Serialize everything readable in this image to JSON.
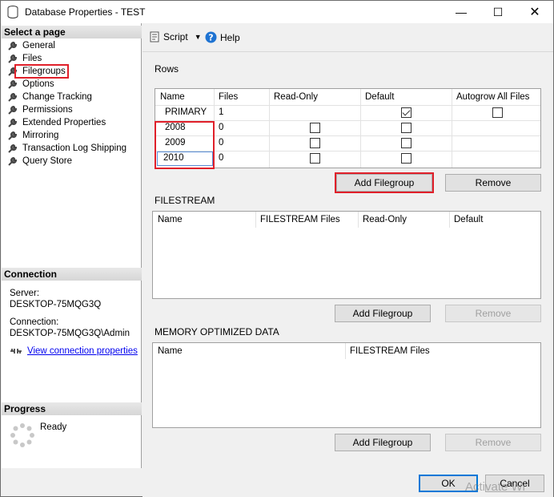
{
  "window": {
    "title": "Database Properties - TEST",
    "min_icon": "—",
    "max_icon": "☐",
    "close_icon": "✕"
  },
  "left": {
    "select_page_header": "Select a page",
    "pages": [
      {
        "label": "General"
      },
      {
        "label": "Files"
      },
      {
        "label": "Filegroups"
      },
      {
        "label": "Options"
      },
      {
        "label": "Change Tracking"
      },
      {
        "label": "Permissions"
      },
      {
        "label": "Extended Properties"
      },
      {
        "label": "Mirroring"
      },
      {
        "label": "Transaction Log Shipping"
      },
      {
        "label": "Query Store"
      }
    ],
    "connection_header": "Connection",
    "server_label": "Server:",
    "server_value": "DESKTOP-75MQG3Q",
    "connection_label": "Connection:",
    "connection_value": "DESKTOP-75MQG3Q\\Admin",
    "view_connection_link": "View connection properties",
    "progress_header": "Progress",
    "progress_status": "Ready"
  },
  "toolbar": {
    "script_label": "Script",
    "help_label": "Help"
  },
  "rows_section": {
    "title": "Rows",
    "headers": [
      "Name",
      "Files",
      "Read-Only",
      "Default",
      "Autogrow All Files"
    ],
    "rows": [
      {
        "name": "PRIMARY",
        "files": "1",
        "read_only": false,
        "default": true,
        "autogrow": false
      },
      {
        "name": "2008",
        "files": "0",
        "read_only": false,
        "default": false,
        "autogrow": null
      },
      {
        "name": "2009",
        "files": "0",
        "read_only": false,
        "default": false,
        "autogrow": null
      },
      {
        "name": "2010",
        "files": "0",
        "read_only": false,
        "default": false,
        "autogrow": null
      }
    ],
    "add_button": "Add Filegroup",
    "remove_button": "Remove"
  },
  "filestream_section": {
    "title": "FILESTREAM",
    "headers": [
      "Name",
      "FILESTREAM Files",
      "Read-Only",
      "Default"
    ],
    "add_button": "Add Filegroup",
    "remove_button": "Remove"
  },
  "memory_section": {
    "title": "MEMORY OPTIMIZED DATA",
    "headers": [
      "Name",
      "FILESTREAM Files"
    ],
    "add_button": "Add Filegroup",
    "remove_button": "Remove"
  },
  "footer": {
    "ok_label": "OK",
    "cancel_label": "Cancel",
    "watermark": "Activate Wi"
  },
  "colors": {
    "highlight_red": "#e0202a",
    "link_blue": "#0000ee",
    "accent_blue": "#0078d7"
  }
}
